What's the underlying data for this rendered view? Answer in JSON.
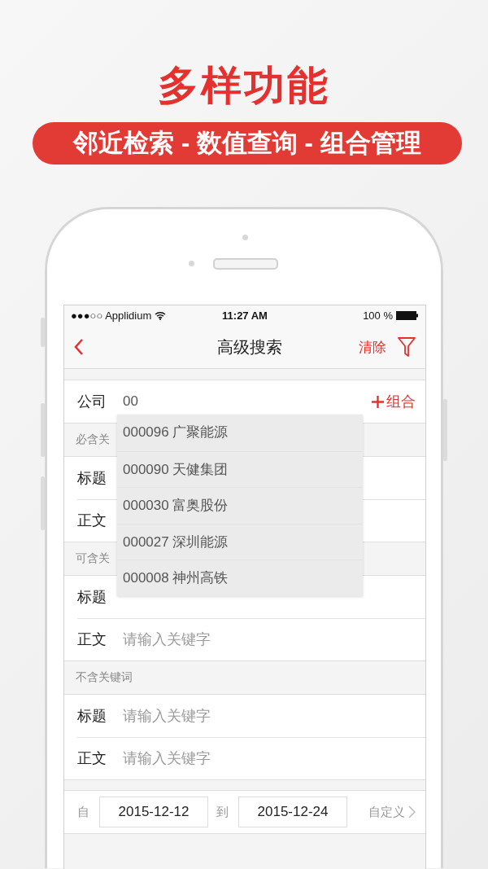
{
  "promo": {
    "title": "多样功能",
    "subtitle": "邻近检索 - 数值查询 - 组合管理"
  },
  "status_bar": {
    "carrier": "●●●○○ Applidium",
    "time": "11:27 AM",
    "battery": "100 %"
  },
  "nav": {
    "title": "高级搜索",
    "clear": "清除"
  },
  "company": {
    "label": "公司",
    "value": "00",
    "add": "组合"
  },
  "sections": [
    {
      "header": "必含关",
      "rows": [
        {
          "label": "标题"
        },
        {
          "label": "正文"
        }
      ]
    },
    {
      "header": "可含关",
      "rows": [
        {
          "label": "标题"
        },
        {
          "label": "正文",
          "placeholder": "请输入关键字"
        }
      ]
    },
    {
      "header": "不含关键词",
      "rows": [
        {
          "label": "标题",
          "placeholder": "请输入关键字"
        },
        {
          "label": "正文",
          "placeholder": "请输入关键字"
        }
      ]
    }
  ],
  "dropdown": [
    "000096 广聚能源",
    "000090 天健集团",
    "000030 富奥股份",
    "000027 深圳能源",
    "000008 神州高铁"
  ],
  "date_range": {
    "from_label": "自",
    "from": "2015-12-12",
    "to_label": "到",
    "to": "2015-12-24",
    "custom": "自定义"
  }
}
